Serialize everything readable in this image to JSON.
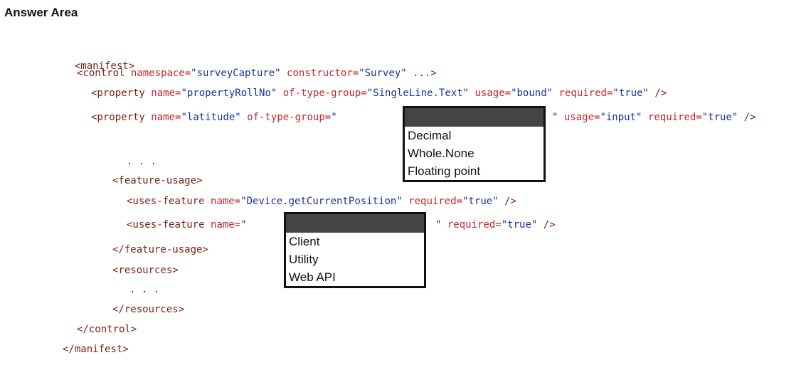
{
  "title": "Answer Area",
  "code": {
    "manifest_open": "<manifest>",
    "control": {
      "open": "<control",
      "attr1": "namespace=",
      "val1": "\"surveyCapture\"",
      "attr2": "constructor=",
      "val2": "\"Survey\"",
      "end": "...>"
    },
    "prop1": {
      "open": "<property",
      "attr1": "name=",
      "val1": "\"propertyRollNo\"",
      "attr2": "of-type-group=",
      "val2": "\"SingleLine.Text\"",
      "attr3": "usage=",
      "val3": "\"bound\"",
      "attr4": "required=",
      "val4": "\"true\"",
      "close": "/>"
    },
    "prop2": {
      "open": "<property",
      "attr1": "name=",
      "val1": "\"latitude\"",
      "attr2": "of-type-group=",
      "quote": "\"",
      "quote2": "\"",
      "attr3": "usage=",
      "val3": "\"input\"",
      "attr4": "required=",
      "val4": "\"true\"",
      "close": "/>"
    },
    "dots1": ". . .",
    "feature_usage_open": "<feature-usage>",
    "uses1": {
      "open": "<uses-feature",
      "attr1": "name=",
      "val1": "\"Device.getCurrentPosition\"",
      "attr2": "required=",
      "val2": "\"true\"",
      "close": "/>"
    },
    "uses2": {
      "open": "<uses-feature",
      "attr1": "name=",
      "quote": "\"",
      "quote2": "\"",
      "attr2": "required=",
      "val2": "\"true\"",
      "close": "/>"
    },
    "feature_usage_close": "</feature-usage>",
    "resources_open": "<resources>",
    "dots2": ". . .",
    "resources_close": "</resources>",
    "control_close": "</control>",
    "manifest_close": "</manifest>"
  },
  "dropdown1": {
    "options": [
      "Decimal",
      "Whole.None",
      "Floating point"
    ]
  },
  "dropdown2": {
    "options": [
      "Client",
      "Utility",
      "Web API"
    ]
  }
}
